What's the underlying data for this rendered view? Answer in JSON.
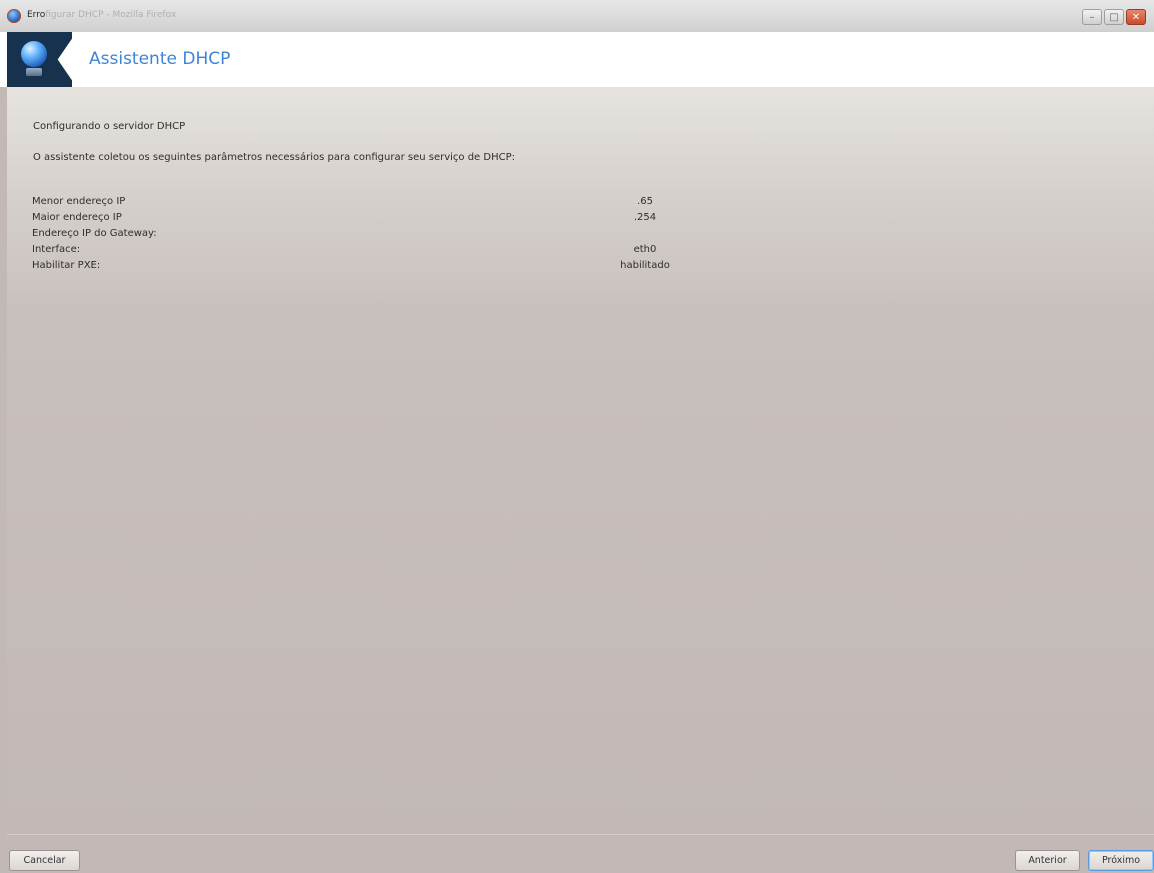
{
  "window": {
    "title_prefix": "Erro",
    "title_ghost": "figurar DHCP - Mozilla Firefox",
    "minimize_glyph": "–",
    "maximize_glyph": "□",
    "close_glyph": "✕"
  },
  "header": {
    "title": "Assistente DHCP",
    "logo_icon": "network-globe-icon"
  },
  "content": {
    "heading": "Configurando o servidor DHCP",
    "description": "O assistente coletou os seguintes parâmetros necessários para configurar seu serviço de DHCP:",
    "params": [
      {
        "label": "Menor endereço IP",
        "value": ".65"
      },
      {
        "label": "Maior endereço IP",
        "value": ".254"
      },
      {
        "label": "Endereço IP do Gateway:",
        "value": ""
      },
      {
        "label": "Interface:",
        "value": "eth0"
      },
      {
        "label": "Habilitar PXE:",
        "value": "habilitado"
      }
    ]
  },
  "buttons": {
    "cancel": "Cancelar",
    "previous": "Anterior",
    "next": "Próximo"
  },
  "colors": {
    "title_accent": "#3f84d8",
    "background": "#c2b9b6",
    "logo_bg": "#17324f"
  }
}
